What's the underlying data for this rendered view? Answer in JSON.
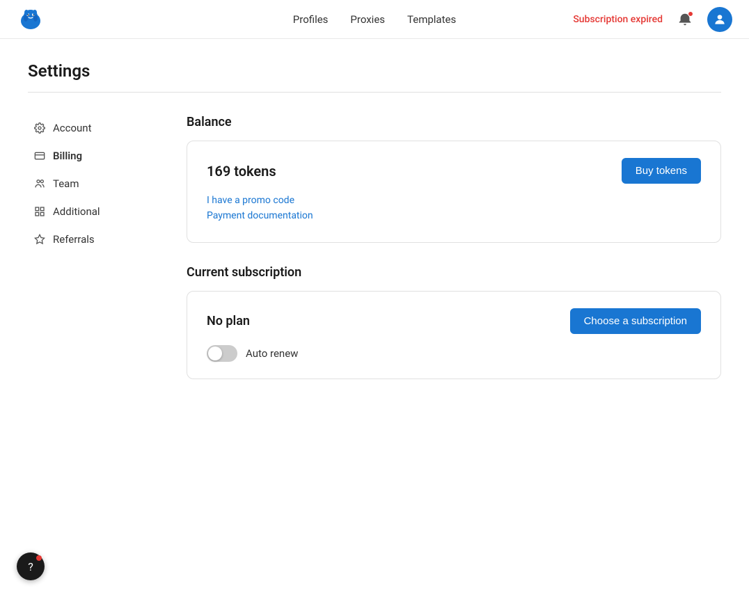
{
  "nav": {
    "links": [
      {
        "label": "Profiles",
        "name": "profiles"
      },
      {
        "label": "Proxies",
        "name": "proxies"
      },
      {
        "label": "Templates",
        "name": "templates"
      }
    ],
    "subscription_status": "Subscription expired"
  },
  "page": {
    "title": "Settings"
  },
  "sidebar": {
    "items": [
      {
        "label": "Account",
        "icon": "gear",
        "name": "account"
      },
      {
        "label": "Billing",
        "icon": "billing",
        "name": "billing",
        "active": true
      },
      {
        "label": "Team",
        "icon": "team",
        "name": "team"
      },
      {
        "label": "Additional",
        "icon": "grid",
        "name": "additional"
      },
      {
        "label": "Referrals",
        "icon": "star",
        "name": "referrals"
      }
    ]
  },
  "balance": {
    "section_title": "Balance",
    "token_amount": "169 tokens",
    "buy_tokens_label": "Buy tokens",
    "promo_code_label": "I have a promo code",
    "payment_docs_label": "Payment documentation"
  },
  "subscription": {
    "section_title": "Current subscription",
    "plan_label": "No plan",
    "choose_btn_label": "Choose a subscription",
    "auto_renew_label": "Auto renew",
    "auto_renew_on": false
  },
  "help": {
    "icon": "?"
  }
}
